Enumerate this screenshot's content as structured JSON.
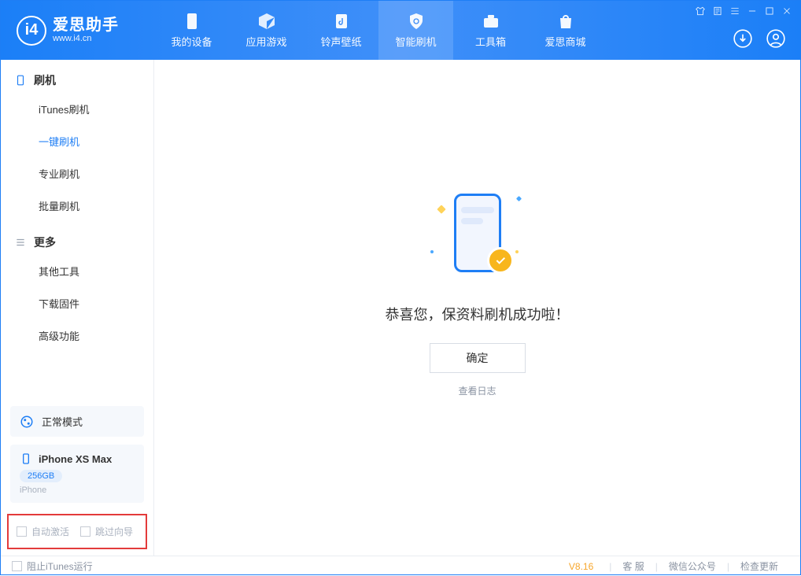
{
  "app": {
    "title": "爱思助手",
    "subtitle": "www.i4.cn"
  },
  "tabs": {
    "device": "我的设备",
    "apps": "应用游戏",
    "ringtone": "铃声壁纸",
    "flash": "智能刷机",
    "toolbox": "工具箱",
    "store": "爱思商城"
  },
  "sidebar": {
    "group_flash": "刷机",
    "items_flash": {
      "itunes": "iTunes刷机",
      "oneclick": "一键刷机",
      "pro": "专业刷机",
      "batch": "批量刷机"
    },
    "group_more": "更多",
    "items_more": {
      "other": "其他工具",
      "firmware": "下载固件",
      "advanced": "高级功能"
    },
    "mode": "正常模式",
    "device": {
      "name": "iPhone XS Max",
      "storage": "256GB",
      "type": "iPhone"
    },
    "opt_activate": "自动激活",
    "opt_skip": "跳过向导"
  },
  "main": {
    "success": "恭喜您，保资料刷机成功啦！",
    "ok": "确定",
    "viewlog": "查看日志"
  },
  "footer": {
    "stop_itunes": "阻止iTunes运行",
    "version": "V8.16",
    "service": "客 服",
    "wechat": "微信公众号",
    "update": "检查更新"
  }
}
